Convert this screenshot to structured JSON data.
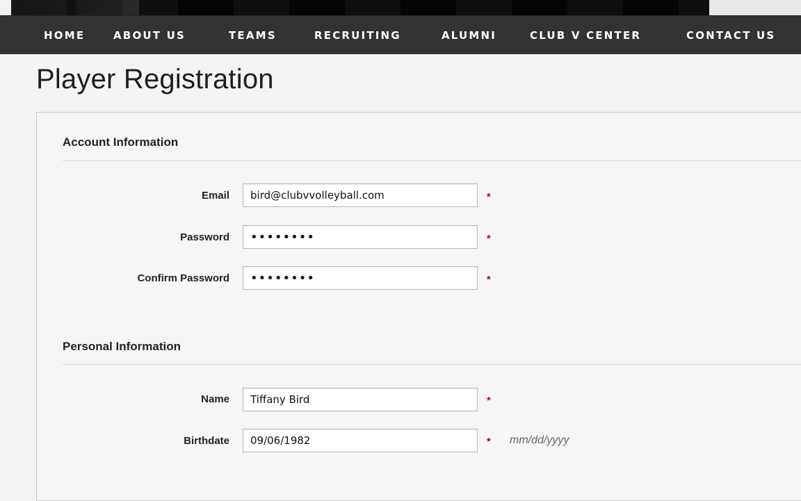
{
  "nav": {
    "items": [
      {
        "label": "HOME"
      },
      {
        "label": "ABOUT US"
      },
      {
        "label": "TEAMS"
      },
      {
        "label": "RECRUITING"
      },
      {
        "label": "ALUMNI"
      },
      {
        "label": "CLUB V CENTER"
      },
      {
        "label": "CONTACT US"
      }
    ]
  },
  "page": {
    "title": "Player Registration"
  },
  "account": {
    "heading": "Account Information",
    "email_label": "Email",
    "email_value": "bird@clubvvolleyball.com",
    "password_label": "Password",
    "password_value": "••••••••",
    "confirm_label": "Confirm Password",
    "confirm_value": "••••••••"
  },
  "personal": {
    "heading": "Personal Information",
    "name_label": "Name",
    "name_value": "Tiffany Bird",
    "birthdate_label": "Birthdate",
    "birthdate_value": "09/06/1982",
    "birthdate_hint": "mm/dd/yyyy"
  },
  "required_marker": "*",
  "colors": {
    "nav_bg": "#333333",
    "required": "#8b1a1a",
    "panel_border": "#c9c9c9"
  }
}
